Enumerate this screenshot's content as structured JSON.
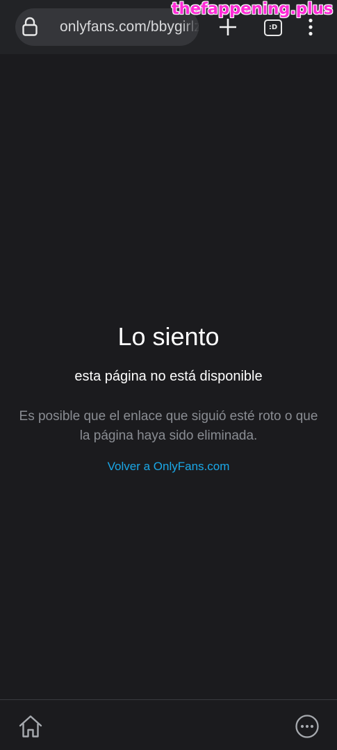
{
  "browser": {
    "url": "onlyfans.com/bbygirlz",
    "tabs_label": ":D",
    "watermark": "thefappening.plus"
  },
  "error_page": {
    "title": "Lo siento",
    "subtitle": "esta página no está disponible",
    "description": "Es posible que el enlace que siguió esté roto o que la página haya sido eliminada.",
    "back_link": "Volver a OnlyFans.com"
  },
  "icons": {
    "lock": "lock-icon",
    "new_tab": "plus-icon",
    "tabs": "tabs-icon",
    "menu": "kebab-menu-icon",
    "home": "home-icon",
    "more": "more-options-icon"
  },
  "colors": {
    "background": "#1b1b1e",
    "toolbar": "#222326",
    "url_pill": "#35363a",
    "link": "#1aa8e8",
    "muted_text": "#8a8d93",
    "watermark": "#ff2bd6"
  }
}
